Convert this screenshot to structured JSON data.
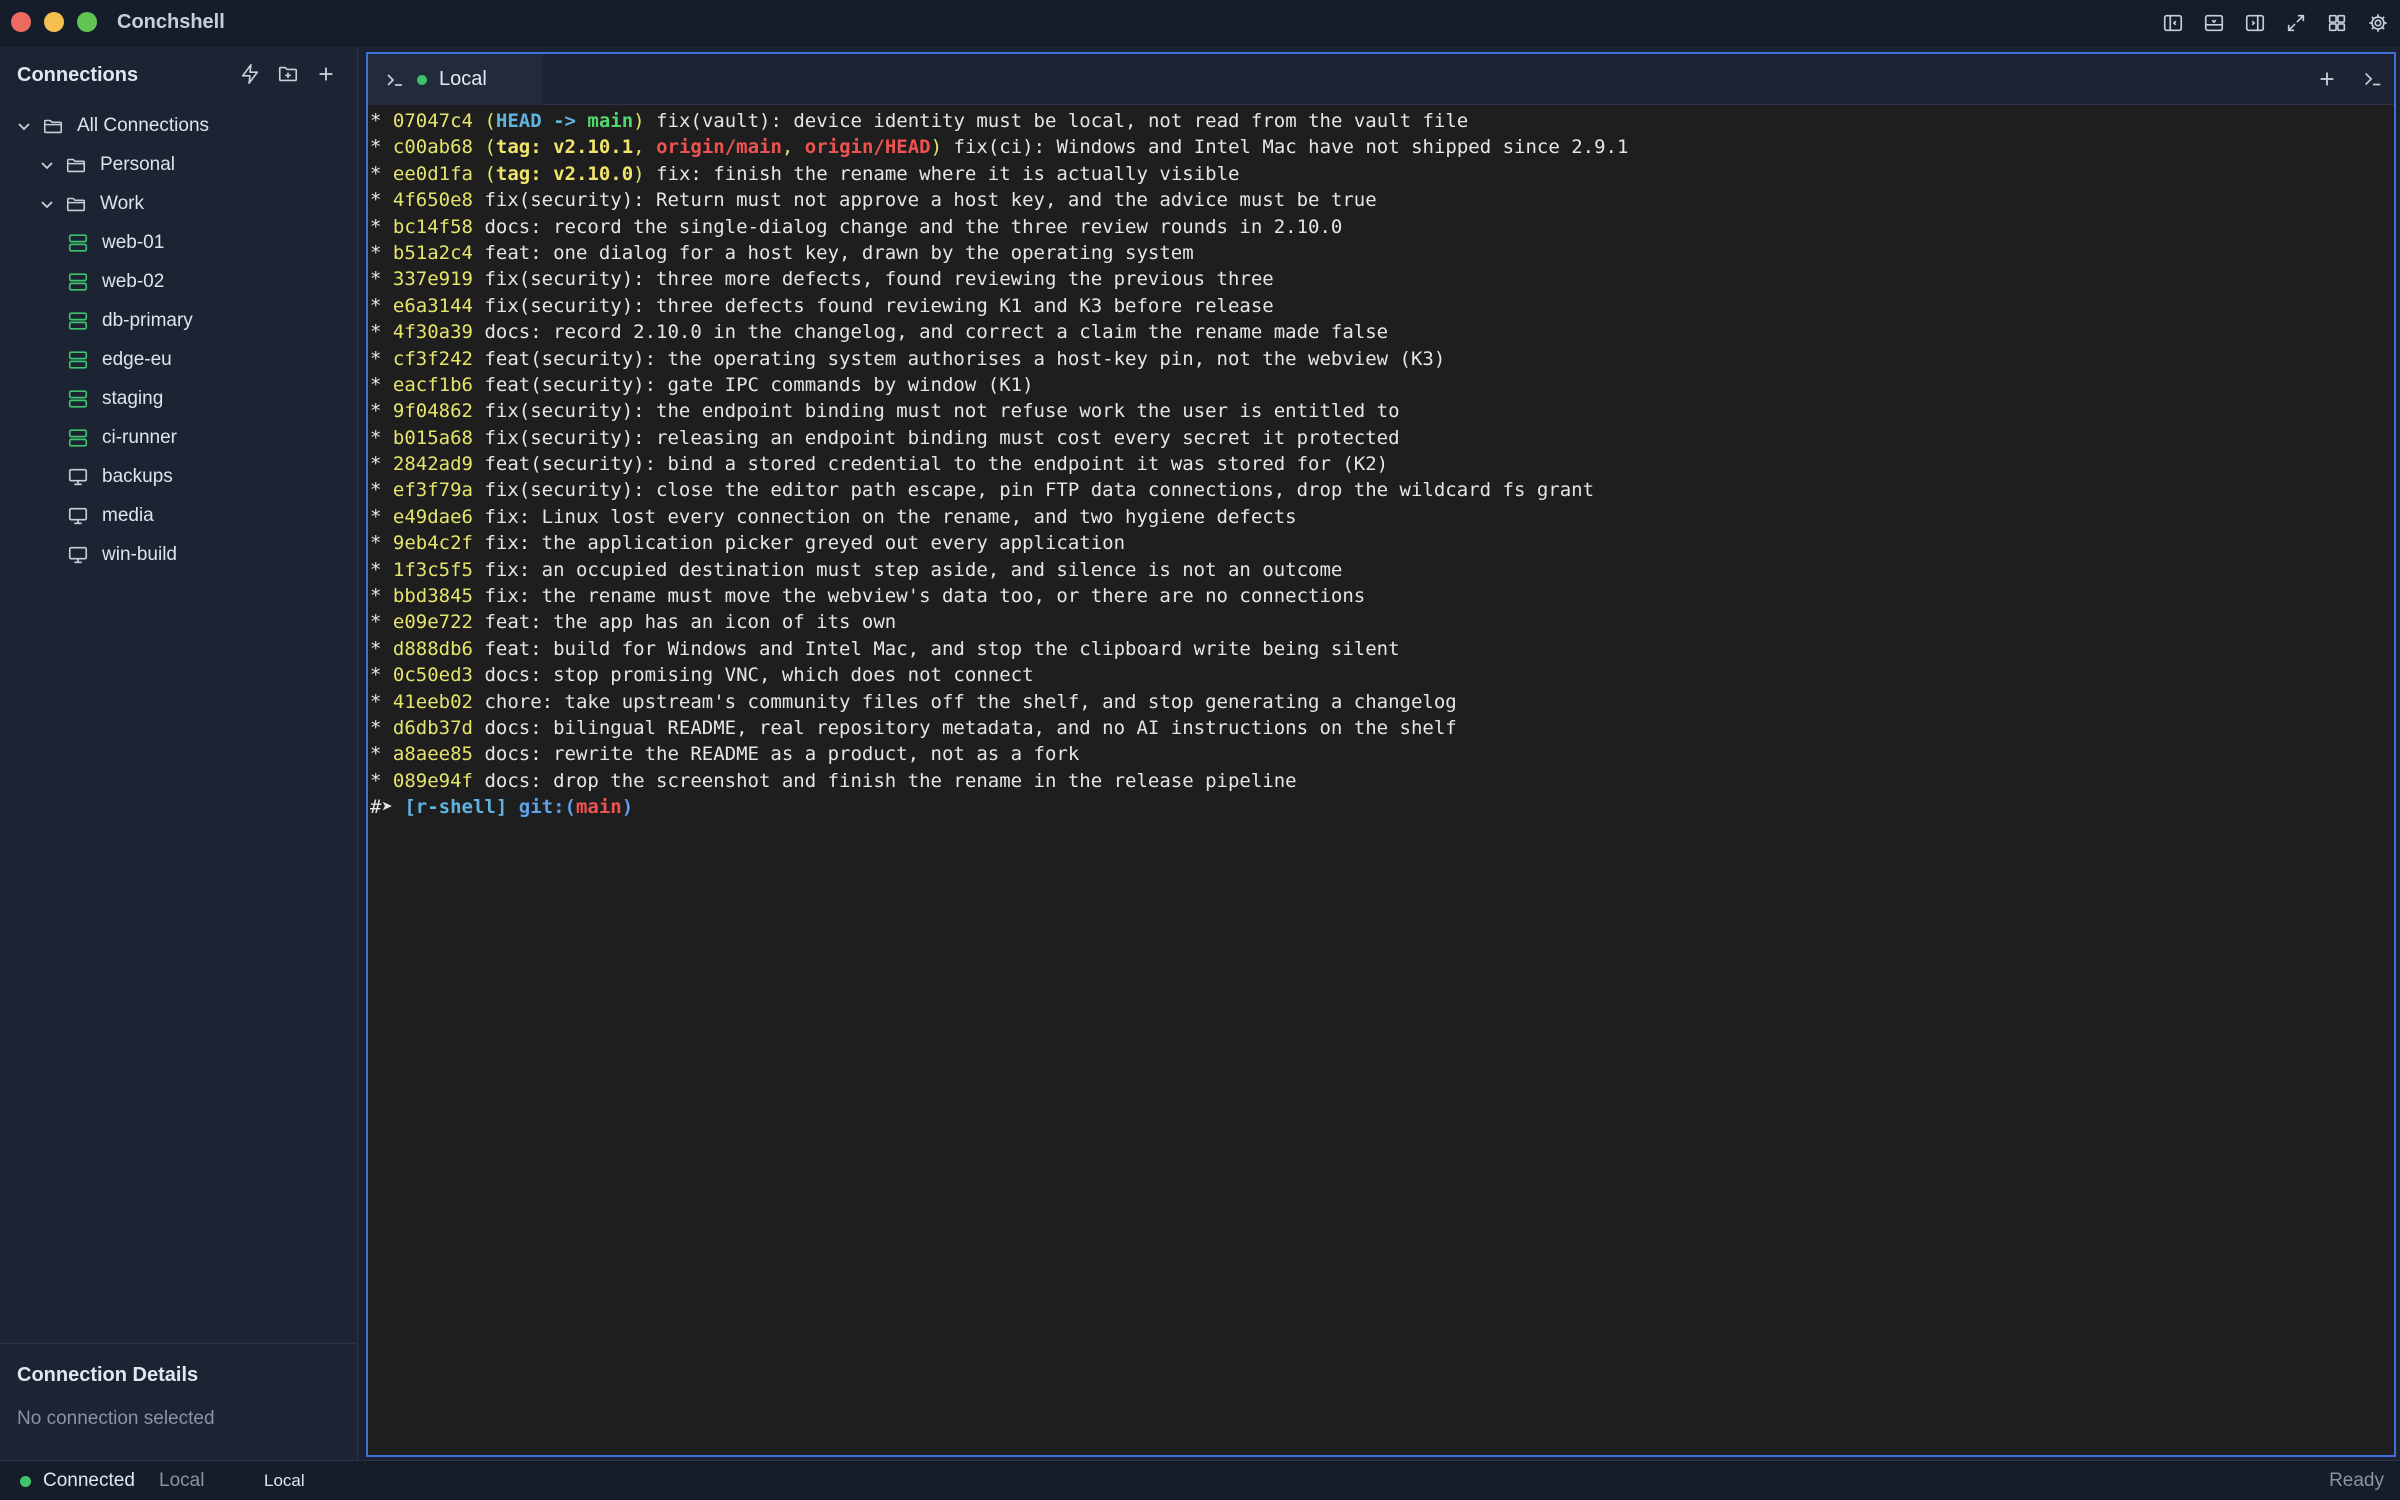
{
  "app": {
    "title": "Conchshell"
  },
  "colors": {
    "accent": "#3f6fd8",
    "connected": "#3ec46d",
    "server_icon": "#3ec46d"
  },
  "sidebar": {
    "title": "Connections",
    "actions": [
      "lightning-icon",
      "folder-plus-icon",
      "plus-icon"
    ],
    "tree": {
      "root": {
        "label": "All Connections",
        "icon": "folder-icon"
      },
      "groups": [
        {
          "label": "Personal",
          "icon": "folder-icon"
        },
        {
          "label": "Work",
          "icon": "folder-icon"
        }
      ],
      "items": [
        {
          "label": "web-01",
          "icon": "server-icon"
        },
        {
          "label": "web-02",
          "icon": "server-icon"
        },
        {
          "label": "db-primary",
          "icon": "server-icon"
        },
        {
          "label": "edge-eu",
          "icon": "server-icon"
        },
        {
          "label": "staging",
          "icon": "server-icon"
        },
        {
          "label": "ci-runner",
          "icon": "server-icon"
        },
        {
          "label": "backups",
          "icon": "monitor-icon"
        },
        {
          "label": "media",
          "icon": "monitor-icon"
        },
        {
          "label": "win-build",
          "icon": "monitor-icon"
        }
      ]
    },
    "details": {
      "title": "Connection Details",
      "empty": "No connection selected"
    }
  },
  "tabs": [
    {
      "label": "Local",
      "status": "connected"
    }
  ],
  "terminal": {
    "star": "*",
    "first": {
      "hash": "07047c4",
      "head": "HEAD -> ",
      "branch": "main",
      "msg": " fix(vault): device identity must be local, not read from the vault file"
    },
    "second": {
      "hash": "c00ab68",
      "tag": "tag: v2.10.1",
      "sep1": ", ",
      "origin1": "origin/main",
      "sep2": ", ",
      "origin2": "origin/HEAD",
      "msg": " fix(ci): Windows and Intel Mac have not shipped since 2.9.1"
    },
    "third": {
      "hash": "ee0d1fa",
      "tag": "tag: v2.10.0",
      "msg": " fix: finish the rename where it is actually visible"
    },
    "commits": [
      {
        "hash": "4f650e8",
        "msg": "fix(security): Return must not approve a host key, and the advice must be true"
      },
      {
        "hash": "bc14f58",
        "msg": "docs: record the single-dialog change and the three review rounds in 2.10.0"
      },
      {
        "hash": "b51a2c4",
        "msg": "feat: one dialog for a host key, drawn by the operating system"
      },
      {
        "hash": "337e919",
        "msg": "fix(security): three more defects, found reviewing the previous three"
      },
      {
        "hash": "e6a3144",
        "msg": "fix(security): three defects found reviewing K1 and K3 before release"
      },
      {
        "hash": "4f30a39",
        "msg": "docs: record 2.10.0 in the changelog, and correct a claim the rename made false"
      },
      {
        "hash": "cf3f242",
        "msg": "feat(security): the operating system authorises a host-key pin, not the webview (K3)"
      },
      {
        "hash": "eacf1b6",
        "msg": "feat(security): gate IPC commands by window (K1)"
      },
      {
        "hash": "9f04862",
        "msg": "fix(security): the endpoint binding must not refuse work the user is entitled to"
      },
      {
        "hash": "b015a68",
        "msg": "fix(security): releasing an endpoint binding must cost every secret it protected"
      },
      {
        "hash": "2842ad9",
        "msg": "feat(security): bind a stored credential to the endpoint it was stored for (K2)"
      },
      {
        "hash": "ef3f79a",
        "msg": "fix(security): close the editor path escape, pin FTP data connections, drop the wildcard fs grant"
      },
      {
        "hash": "e49dae6",
        "msg": "fix: Linux lost every connection on the rename, and two hygiene defects"
      },
      {
        "hash": "9eb4c2f",
        "msg": "fix: the application picker greyed out every application"
      },
      {
        "hash": "1f3c5f5",
        "msg": "fix: an occupied destination must step aside, and silence is not an outcome"
      },
      {
        "hash": "bbd3845",
        "msg": "fix: the rename must move the webview's data too, or there are no connections"
      },
      {
        "hash": "e09e722",
        "msg": "feat: the app has an icon of its own"
      },
      {
        "hash": "d888db6",
        "msg": "feat: build for Windows and Intel Mac, and stop the clipboard write being silent"
      },
      {
        "hash": "0c50ed3",
        "msg": "docs: stop promising VNC, which does not connect"
      },
      {
        "hash": "41eeb02",
        "msg": "chore: take upstream's community files off the shelf, and stop generating a changelog"
      },
      {
        "hash": "d6db37d",
        "msg": "docs: bilingual README, real repository metadata, and no AI instructions on the shelf"
      },
      {
        "hash": "a8aee85",
        "msg": "docs: rewrite the README as a product, not as a fork"
      },
      {
        "hash": "089e94f",
        "msg": "docs: drop the screenshot and finish the rename in the release pipeline"
      }
    ],
    "prompt": {
      "symbol": "#➤",
      "dir": "[r-shell]",
      "git": "git:",
      "branch": "main"
    }
  },
  "statusbar": {
    "connected": "Connected",
    "host": "Local",
    "tab": "Local",
    "status": "Ready"
  }
}
